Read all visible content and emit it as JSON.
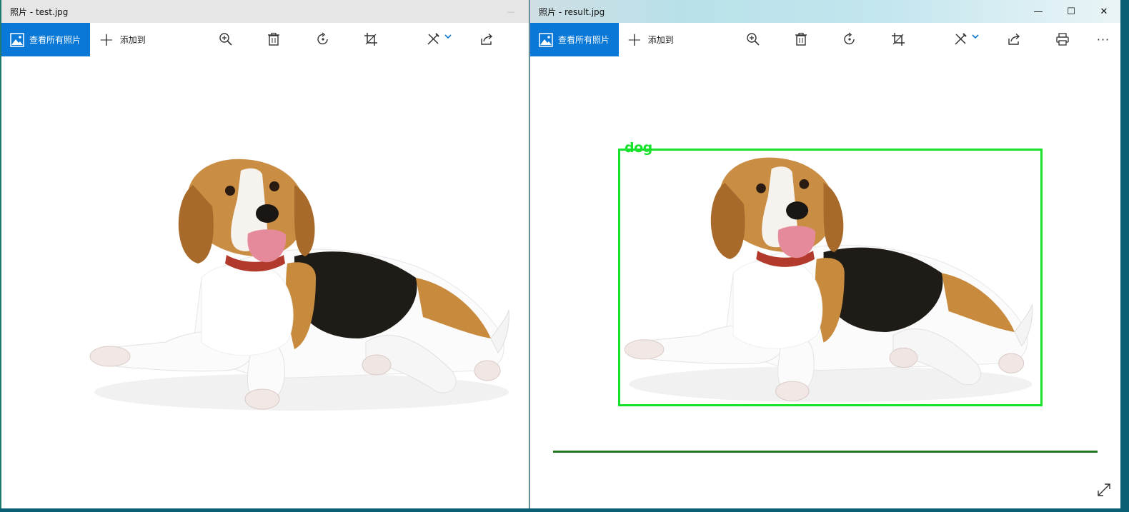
{
  "left_window": {
    "title": "照片 - test.jpg",
    "toolbar": {
      "view_all_label": "查看所有照片",
      "add_to_label": "添加到",
      "icons": [
        "zoom-in-icon",
        "delete-icon",
        "rotate-icon",
        "crop-icon",
        "edit-icon",
        "share-icon"
      ]
    },
    "minimize_glyph": "—"
  },
  "right_window": {
    "title": "照片 - result.jpg",
    "toolbar": {
      "view_all_label": "查看所有照片",
      "add_to_label": "添加到",
      "icons": [
        "zoom-in-icon",
        "delete-icon",
        "rotate-icon",
        "crop-icon",
        "edit-icon",
        "share-icon",
        "print-icon",
        "more-icon"
      ],
      "more_glyph": "···"
    },
    "window_controls": {
      "minimize": "—",
      "maximize": "☐",
      "close": "✕"
    },
    "detection": {
      "label": "dog",
      "color": "#16e22b"
    }
  },
  "colors": {
    "accent": "#0a78d7",
    "detection_box": "#16e22b",
    "progress_line": "#1f7a1f"
  }
}
